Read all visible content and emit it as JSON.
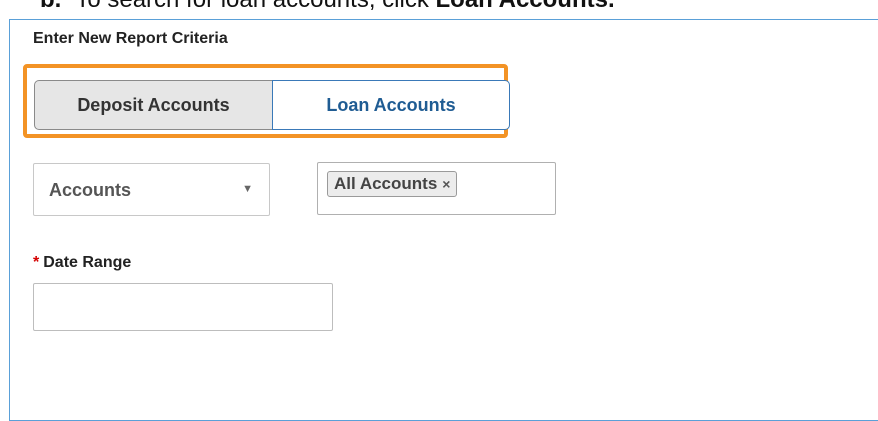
{
  "instruction": {
    "step": "b.",
    "text": "To search for loan accounts, click",
    "target": "Loan Accounts."
  },
  "panel": {
    "title": "Enter New Report Criteria"
  },
  "account_type_toggle": {
    "deposit_label": "Deposit Accounts",
    "loan_label": "Loan Accounts",
    "selected": "Deposit Accounts"
  },
  "filter": {
    "select_value": "Accounts",
    "tag_label": "All Accounts",
    "tag_remove": "×"
  },
  "date_range": {
    "required_marker": "*",
    "label": "Date Range",
    "value": ""
  },
  "colors": {
    "highlight": "#f39325",
    "loan_text": "#1f5c93",
    "panel_border": "#5aa0d8",
    "required": "#d40000"
  }
}
